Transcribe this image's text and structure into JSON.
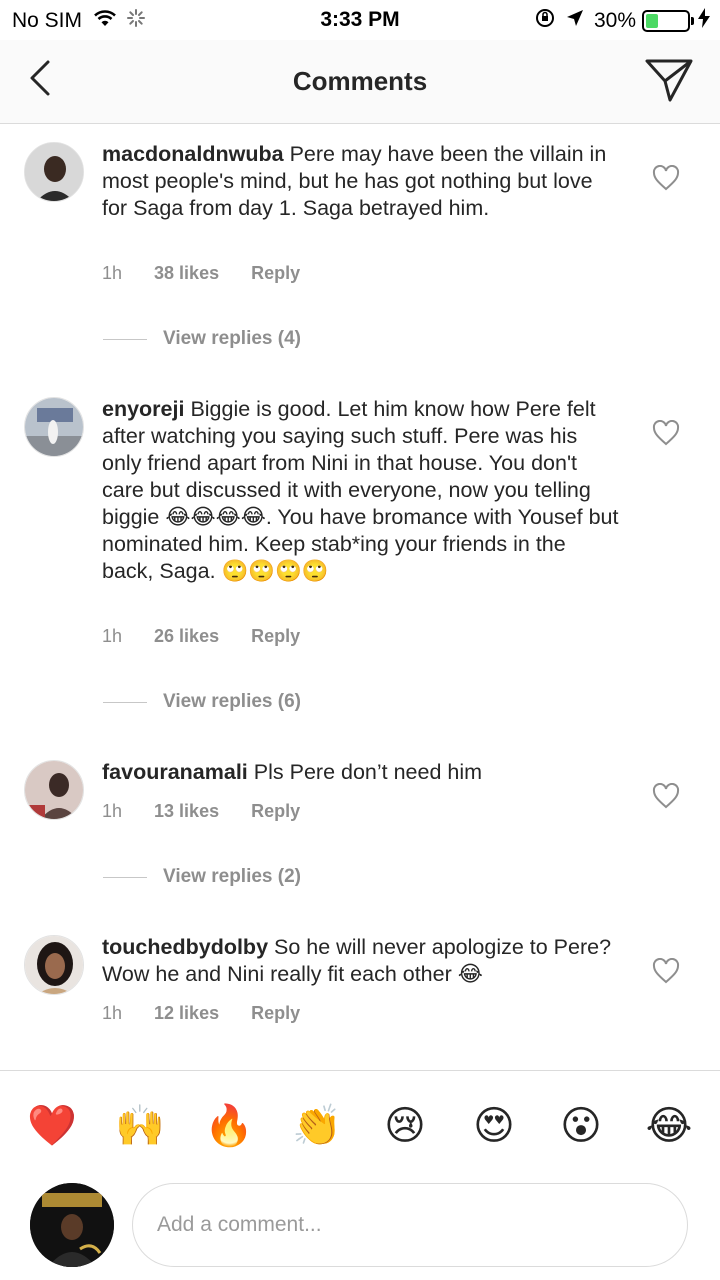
{
  "status_bar": {
    "carrier": "No SIM",
    "time": "3:33 PM",
    "battery": "30%",
    "battery_level": 0.3
  },
  "nav": {
    "title": "Comments",
    "back_icon": "chevron-left-icon",
    "send_icon": "paper-plane-icon"
  },
  "comments": [
    {
      "username": "macdonaldnwuba",
      "text": "Pere may have been the villain in most people's mind, but he has got nothing but love for Saga from day 1. Saga betrayed him.",
      "time": "1h",
      "likes": "38 likes",
      "reply": "Reply",
      "view_replies": "View replies (4)"
    },
    {
      "username": "enyoreji",
      "text": "Biggie is good. Let him know how Pere felt after watching you saying such stuff. Pere was his only friend apart from Nini in that house. You don't care but discussed it with everyone, now you telling biggie 😂😂😂😂. You have bromance with Yousef but nominated him. Keep stab*ing your friends in the back, Saga. 🙄🙄🙄🙄",
      "time": "1h",
      "likes": "26 likes",
      "reply": "Reply",
      "view_replies": "View replies (6)"
    },
    {
      "username": "favouranamali",
      "text": "Pls Pere don’t need him",
      "time": "1h",
      "likes": "13 likes",
      "reply": "Reply",
      "view_replies": "View replies (2)"
    },
    {
      "username": "touchedbydolby",
      "text": "So he will never apologize to Pere? Wow he and Nini really fit each other 😂",
      "time": "1h",
      "likes": "12 likes",
      "reply": "Reply"
    }
  ],
  "emoji_bar": {
    "emojis": [
      "❤️",
      "🙌",
      "🔥",
      "👏",
      "😢",
      "😍",
      "😮",
      "😂"
    ]
  },
  "composer": {
    "placeholder": "Add a comment..."
  },
  "colors": {
    "text": "#262626",
    "meta": "#8e8e8e",
    "divider": "#dbdbdb",
    "battery_green": "#4cd964"
  }
}
